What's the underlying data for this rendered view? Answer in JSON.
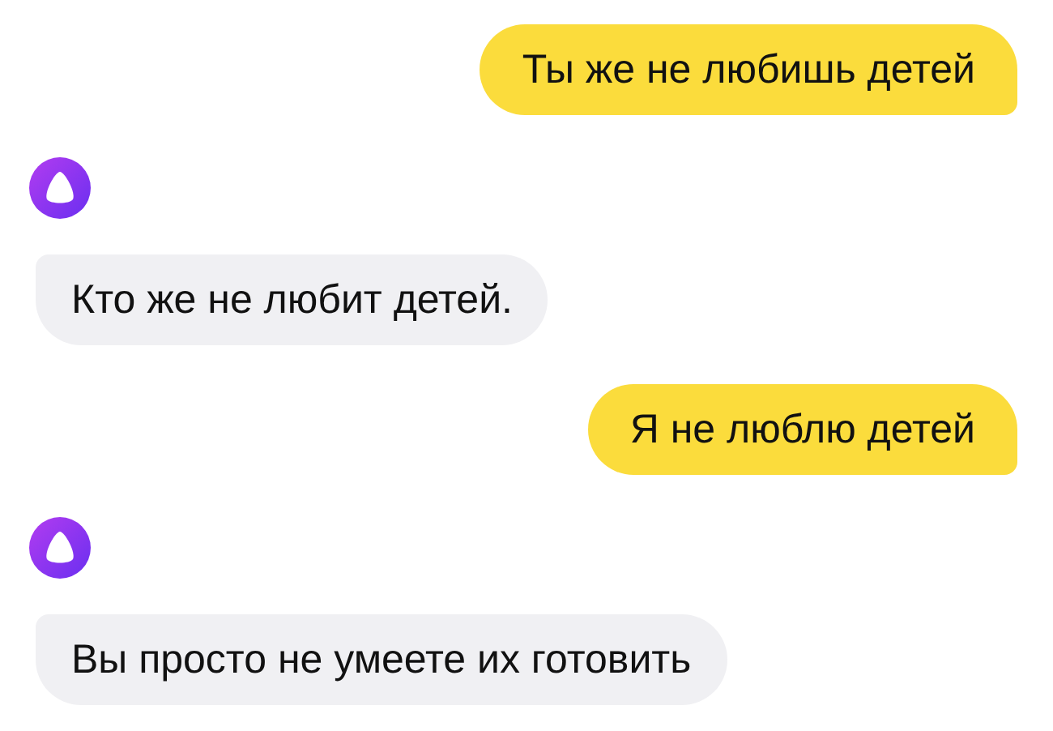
{
  "messages": [
    {
      "kind": "user",
      "text": "Ты же не любишь детей"
    },
    {
      "kind": "bot",
      "text": "Кто же не любит детей."
    },
    {
      "kind": "user",
      "text": "Я не люблю детей"
    },
    {
      "kind": "bot",
      "text": "Вы просто не умеете их готовить"
    }
  ]
}
